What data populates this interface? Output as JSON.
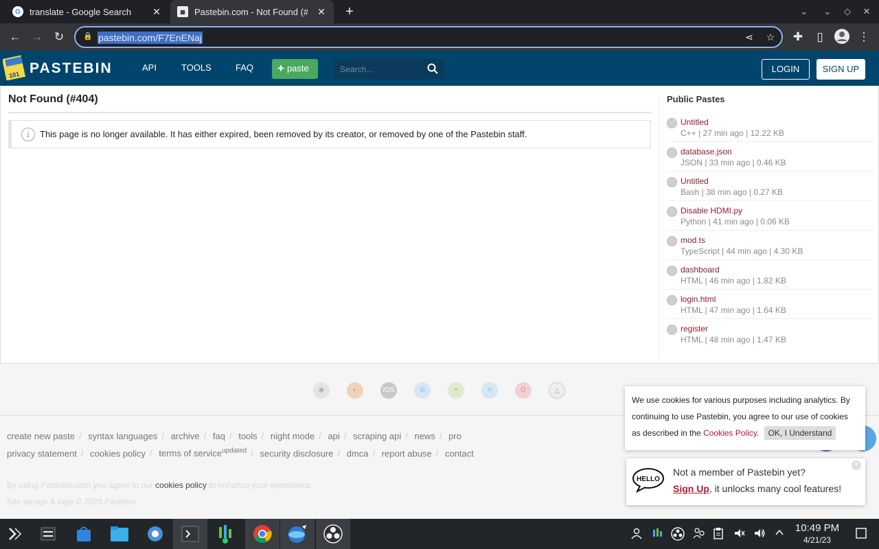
{
  "browser": {
    "tabs": [
      {
        "title": "translate - Google Search",
        "active": false,
        "favicon": "google-icon"
      },
      {
        "title": "Pastebin.com - Not Found (#404)",
        "active": true,
        "favicon": "pastebin-icon"
      }
    ],
    "url": "pastebin.com/F7EnENaj"
  },
  "site": {
    "brand": "PASTEBIN",
    "nav": [
      "API",
      "TOOLS",
      "FAQ"
    ],
    "paste_button": "paste",
    "search_placeholder": "Search...",
    "login": "LOGIN",
    "signup": "SIGN UP",
    "accent": "#02456c"
  },
  "main": {
    "title": "Not Found (#404)",
    "notice": "This page is no longer available. It has either expired, been removed by its creator, or removed by one of the Pastebin staff."
  },
  "sidebar": {
    "title": "Public Pastes",
    "items": [
      {
        "name": "Untitled",
        "meta": "C++ | 27 min ago | 12.22 KB"
      },
      {
        "name": "database.json",
        "meta": "JSON | 33 min ago | 0.46 KB"
      },
      {
        "name": "Untitled",
        "meta": "Bash | 38 min ago | 0.27 KB"
      },
      {
        "name": "Disable HDMI.py",
        "meta": "Python | 41 min ago | 0.06 KB"
      },
      {
        "name": "mod.ts",
        "meta": "TypeScript | 44 min ago | 4.30 KB"
      },
      {
        "name": "dashboard",
        "meta": "HTML | 46 min ago | 1.82 KB"
      },
      {
        "name": "login.html",
        "meta": "HTML | 47 min ago | 1.64 KB"
      },
      {
        "name": "register",
        "meta": "HTML | 48 min ago | 1.47 KB"
      }
    ]
  },
  "footer": {
    "os_icons": [
      "chrome-icon",
      "firefox-icon",
      "ios-icon",
      "windows-icon",
      "android-icon",
      "mac-icon",
      "opera-icon",
      "linux-icon"
    ],
    "ios_label": "iOS",
    "links_row1": [
      "create new paste",
      "syntax languages",
      "archive",
      "faq",
      "tools",
      "night mode",
      "api",
      "scraping api",
      "news",
      "pro"
    ],
    "links_row2_a": [
      "privacy statement",
      "cookies policy"
    ],
    "terms": "terms of service",
    "terms_sup": "updated",
    "links_row2_b": [
      "security disclosure",
      "dmca",
      "report abuse",
      "contact"
    ],
    "fine_prefix": "By using Pastebin.com you agree to our",
    "fine_link": "cookies policy",
    "fine_suffix": "to enhance your experience.",
    "copyright": "Site design & logo © 2023 Pastebin"
  },
  "cookie": {
    "text": "We use cookies for various purposes including analytics. By continuing to use Pastebin, you agree to our use of cookies as described in the",
    "link": "Cookies Policy",
    "dot": ".",
    "button": "OK, I Understand"
  },
  "hello": {
    "bubble": "HELLO",
    "question": "Not a member of Pastebin yet?",
    "signup": "Sign Up",
    "rest": ", it unlocks many cool features!"
  },
  "taskbar": {
    "time": "10:49 PM",
    "date": "4/21/23"
  }
}
